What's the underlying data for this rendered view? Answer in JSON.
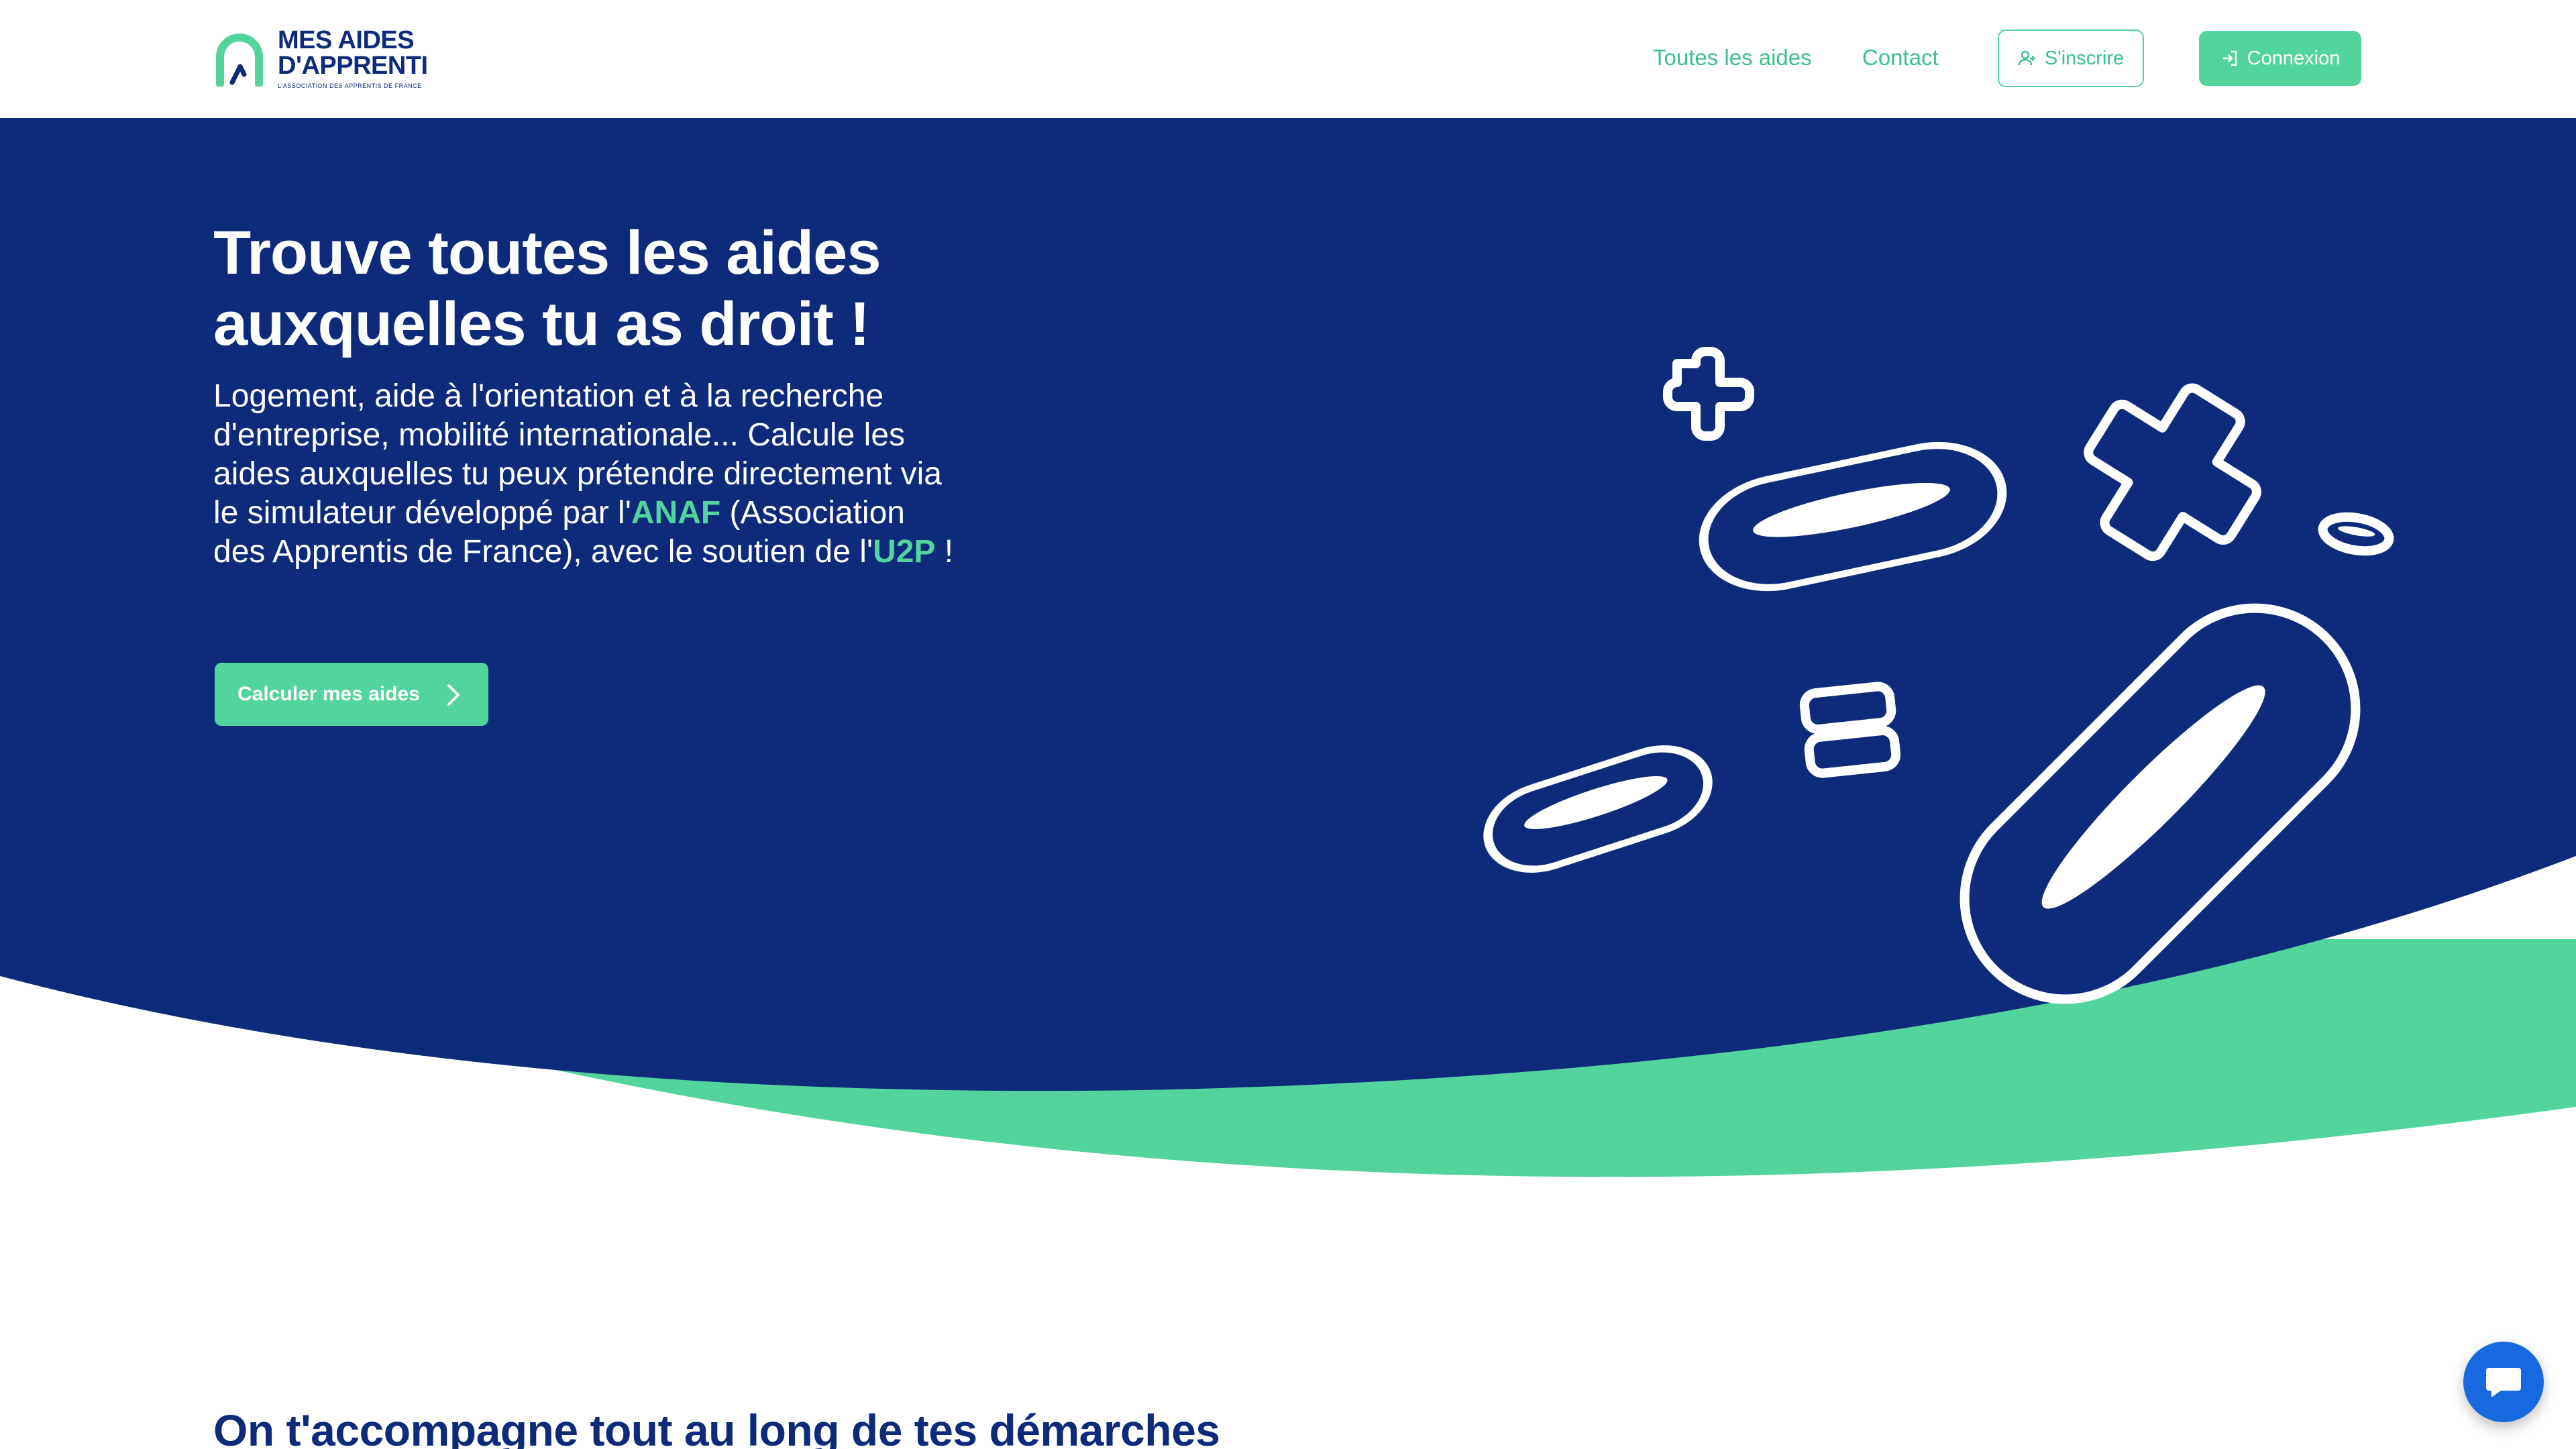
{
  "header": {
    "logo": {
      "line1": "MES AIDES",
      "line2": "D'APPRENTI",
      "tagline": "L'ASSOCIATION DES APPRENTIS DE FRANCE",
      "icon": "logo-mark"
    },
    "nav": {
      "all_aids": "Toutes les aides",
      "contact": "Contact"
    },
    "signup_label": "S'inscrire",
    "signup_icon": "user-plus-icon",
    "login_label": "Connexion",
    "login_icon": "login-icon"
  },
  "hero": {
    "title": "Trouve toutes les aides auxquelles tu as droit !",
    "text_part1": "Logement, aide à l'orientation et à la recherche d'entreprise, mobilité internationale... Calcule les aides auxquelles tu peux prétendre directement via le simulateur développé par l'",
    "highlight1": "ANAF",
    "text_part2": " (Association des Apprentis de France), avec le soutien de l'",
    "highlight2": "U2P",
    "text_part3": " !",
    "cta_label": "Calculer mes aides",
    "cta_icon": "chevron-right-icon"
  },
  "section": {
    "title": "On t'accompagne tout au long de tes démarches"
  },
  "chat": {
    "icon": "chat-bubble-icon"
  },
  "colors": {
    "navy": "#0d2b7a",
    "green": "#52d49c",
    "green_text": "#3cc08b",
    "chat_blue": "#1769e0",
    "white": "#ffffff"
  }
}
